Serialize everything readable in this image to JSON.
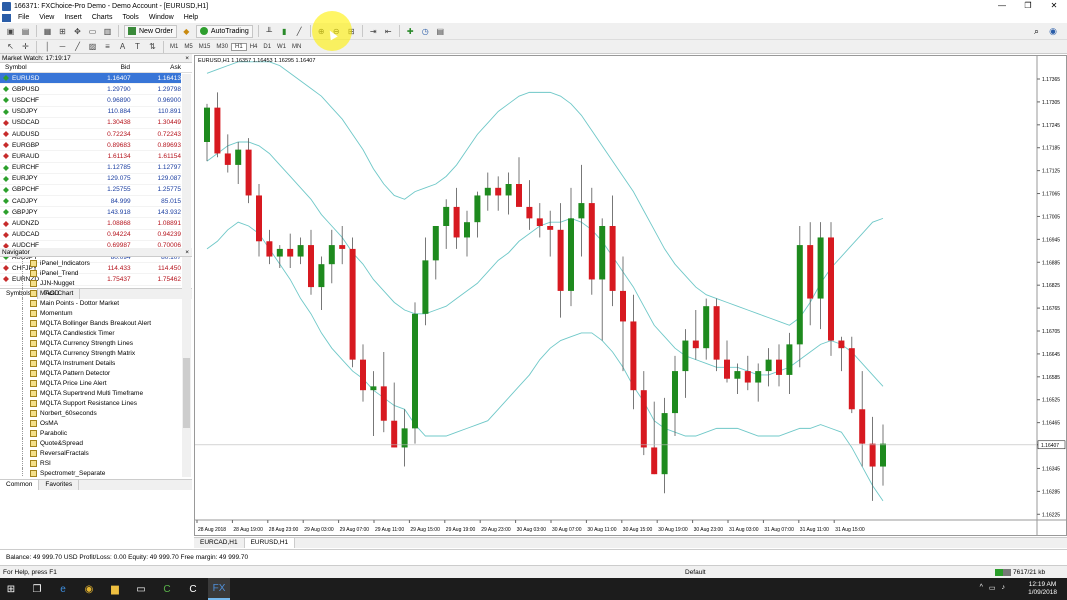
{
  "window": {
    "title": "166371: FXChoice-Pro Demo - Demo Account - [EURUSD,H1]",
    "controls": [
      "—",
      "❐",
      "✕"
    ]
  },
  "menu": [
    "File",
    "View",
    "Insert",
    "Charts",
    "Tools",
    "Window",
    "Help"
  ],
  "toolbar": {
    "new_order": "New Order",
    "autotrading": "AutoTrading"
  },
  "timeframes": [
    "M1",
    "M5",
    "M15",
    "M30",
    "H1",
    "H4",
    "D1",
    "W1",
    "MN"
  ],
  "market_watch": {
    "header": "Market Watch: 17:19:17",
    "columns": [
      "Symbol",
      "Bid",
      "Ask"
    ],
    "rows": [
      {
        "symbol": "EURUSD",
        "bid": "1.16407",
        "ask": "1.16413",
        "dir": "up",
        "selected": true
      },
      {
        "symbol": "GBPUSD",
        "bid": "1.29790",
        "ask": "1.29798",
        "dir": "up"
      },
      {
        "symbol": "USDCHF",
        "bid": "0.96890",
        "ask": "0.96900",
        "dir": "up"
      },
      {
        "symbol": "USDJPY",
        "bid": "110.884",
        "ask": "110.891",
        "dir": "up"
      },
      {
        "symbol": "USDCAD",
        "bid": "1.30438",
        "ask": "1.30449",
        "dir": "down"
      },
      {
        "symbol": "AUDUSD",
        "bid": "0.72234",
        "ask": "0.72243",
        "dir": "down"
      },
      {
        "symbol": "EURGBP",
        "bid": "0.89683",
        "ask": "0.89693",
        "dir": "down"
      },
      {
        "symbol": "EURAUD",
        "bid": "1.61134",
        "ask": "1.61154",
        "dir": "down"
      },
      {
        "symbol": "EURCHF",
        "bid": "1.12785",
        "ask": "1.12797",
        "dir": "up"
      },
      {
        "symbol": "EURJPY",
        "bid": "129.075",
        "ask": "129.087",
        "dir": "up"
      },
      {
        "symbol": "GBPCHF",
        "bid": "1.25755",
        "ask": "1.25775",
        "dir": "up"
      },
      {
        "symbol": "CADJPY",
        "bid": "84.999",
        "ask": "85.015",
        "dir": "up"
      },
      {
        "symbol": "GBPJPY",
        "bid": "143.918",
        "ask": "143.932",
        "dir": "up"
      },
      {
        "symbol": "AUDNZD",
        "bid": "1.08868",
        "ask": "1.08891",
        "dir": "down"
      },
      {
        "symbol": "AUDCAD",
        "bid": "0.94224",
        "ask": "0.94239",
        "dir": "down"
      },
      {
        "symbol": "AUDCHF",
        "bid": "0.69987",
        "ask": "0.70006",
        "dir": "down"
      },
      {
        "symbol": "AUDJPY",
        "bid": "80.094",
        "ask": "80.107",
        "dir": "up"
      },
      {
        "symbol": "CHFJPY",
        "bid": "114.433",
        "ask": "114.450",
        "dir": "down"
      },
      {
        "symbol": "EURNZD",
        "bid": "1.75437",
        "ask": "1.75462",
        "dir": "down"
      }
    ],
    "tabs": [
      "Symbols",
      "Tick Chart"
    ]
  },
  "navigator": {
    "header": "Navigator",
    "items": [
      "iPanel_Indicators",
      "iPanel_Trend",
      "JJN-Nugget",
      "MACD",
      "Main Points - Dottor Market",
      "Momentum",
      "MQLTA Bollinger Bands Breakout Alert",
      "MQLTA Candlestick Timer",
      "MQLTA Currency Strength Lines",
      "MQLTA Currency Strength Matrix",
      "MQLTA Instrument Details",
      "MQLTA Pattern Detector",
      "MQLTA Price Line Alert",
      "MQLTA Supertrend Multi Timeframe",
      "MQLTA Support Resistance Lines",
      "Norbert_60seconds",
      "OsMA",
      "Parabolic",
      "Quote&Spread",
      "ReversalFractals",
      "RSI",
      "Spectrometr_Separate"
    ],
    "tabs": [
      "Common",
      "Favorites"
    ]
  },
  "chart": {
    "label": "EURUSD,H1  1.16357 1.16453 1.16295 1.16407",
    "current_price": "1.16407",
    "tabs": [
      "EURCAD,H1",
      "EURUSD,H1"
    ]
  },
  "chart_data": {
    "type": "candlestick",
    "symbol": "EURUSD",
    "timeframe": "H1",
    "y_ticks": [
      "1.17365",
      "1.17305",
      "1.17245",
      "1.17185",
      "1.17125",
      "1.17065",
      "1.17005",
      "1.16945",
      "1.16885",
      "1.16825",
      "1.16765",
      "1.16705",
      "1.16645",
      "1.16585",
      "1.16525",
      "1.16465",
      "1.16407",
      "1.16345",
      "1.16285",
      "1.16225"
    ],
    "ylim": [
      1.1621,
      1.1742
    ],
    "x_ticks": [
      "28 Aug 2018",
      "28 Aug 19:00",
      "28 Aug 23:00",
      "29 Aug 03:00",
      "29 Aug 07:00",
      "29 Aug 11:00",
      "29 Aug 15:00",
      "29 Aug 19:00",
      "29 Aug 23:00",
      "30 Aug 03:00",
      "30 Aug 07:00",
      "30 Aug 11:00",
      "30 Aug 15:00",
      "30 Aug 19:00",
      "30 Aug 23:00",
      "31 Aug 03:00",
      "31 Aug 07:00",
      "31 Aug 11:00",
      "31 Aug 15:00"
    ],
    "candles": [
      [
        1.172,
        1.173,
        1.1715,
        1.1729
      ],
      [
        1.1729,
        1.1733,
        1.1716,
        1.1717
      ],
      [
        1.1717,
        1.1722,
        1.1712,
        1.1714
      ],
      [
        1.1714,
        1.172,
        1.1709,
        1.1718
      ],
      [
        1.1718,
        1.1721,
        1.1704,
        1.1706
      ],
      [
        1.1706,
        1.1709,
        1.169,
        1.1694
      ],
      [
        1.1694,
        1.1697,
        1.1688,
        1.169
      ],
      [
        1.169,
        1.1693,
        1.1687,
        1.1692
      ],
      [
        1.1692,
        1.1696,
        1.1687,
        1.169
      ],
      [
        1.169,
        1.1695,
        1.1688,
        1.1693
      ],
      [
        1.1693,
        1.1697,
        1.168,
        1.1682
      ],
      [
        1.1682,
        1.169,
        1.1676,
        1.1688
      ],
      [
        1.1688,
        1.1697,
        1.1683,
        1.1693
      ],
      [
        1.1693,
        1.1698,
        1.1688,
        1.1692
      ],
      [
        1.1692,
        1.1695,
        1.1661,
        1.1663
      ],
      [
        1.1663,
        1.1667,
        1.1652,
        1.1655
      ],
      [
        1.1655,
        1.166,
        1.1643,
        1.1656
      ],
      [
        1.1656,
        1.1665,
        1.1644,
        1.1647
      ],
      [
        1.1647,
        1.1657,
        1.164,
        1.164
      ],
      [
        1.164,
        1.165,
        1.1635,
        1.1645
      ],
      [
        1.1645,
        1.1678,
        1.1641,
        1.1675
      ],
      [
        1.1675,
        1.1695,
        1.1672,
        1.1689
      ],
      [
        1.1689,
        1.1698,
        1.1684,
        1.1698
      ],
      [
        1.1698,
        1.1705,
        1.1692,
        1.1703
      ],
      [
        1.1703,
        1.1708,
        1.1692,
        1.1695
      ],
      [
        1.1695,
        1.1702,
        1.169,
        1.1699
      ],
      [
        1.1699,
        1.1707,
        1.1695,
        1.1706
      ],
      [
        1.1706,
        1.1712,
        1.1702,
        1.1708
      ],
      [
        1.1708,
        1.1711,
        1.1702,
        1.1706
      ],
      [
        1.1706,
        1.1712,
        1.1701,
        1.1709
      ],
      [
        1.1709,
        1.1716,
        1.1704,
        1.1703
      ],
      [
        1.1703,
        1.171,
        1.1697,
        1.17
      ],
      [
        1.17,
        1.1704,
        1.1695,
        1.1698
      ],
      [
        1.1698,
        1.1702,
        1.169,
        1.1697
      ],
      [
        1.1697,
        1.1704,
        1.1674,
        1.1681
      ],
      [
        1.1681,
        1.1708,
        1.1677,
        1.17
      ],
      [
        1.17,
        1.1714,
        1.169,
        1.1704
      ],
      [
        1.1704,
        1.1708,
        1.168,
        1.1684
      ],
      [
        1.1684,
        1.17,
        1.1668,
        1.1698
      ],
      [
        1.1698,
        1.1706,
        1.1677,
        1.1681
      ],
      [
        1.1681,
        1.169,
        1.166,
        1.1673
      ],
      [
        1.1673,
        1.168,
        1.165,
        1.1655
      ],
      [
        1.1655,
        1.166,
        1.1638,
        1.164
      ],
      [
        1.164,
        1.1652,
        1.1633,
        1.1633
      ],
      [
        1.1633,
        1.1653,
        1.1628,
        1.1649
      ],
      [
        1.1649,
        1.1664,
        1.1643,
        1.166
      ],
      [
        1.166,
        1.1671,
        1.1653,
        1.1668
      ],
      [
        1.1668,
        1.1676,
        1.1663,
        1.1666
      ],
      [
        1.1666,
        1.1679,
        1.1663,
        1.1677
      ],
      [
        1.1677,
        1.1679,
        1.166,
        1.1663
      ],
      [
        1.1663,
        1.1668,
        1.1657,
        1.1658
      ],
      [
        1.1658,
        1.1662,
        1.1654,
        1.166
      ],
      [
        1.166,
        1.1664,
        1.1655,
        1.1657
      ],
      [
        1.1657,
        1.1662,
        1.1652,
        1.166
      ],
      [
        1.166,
        1.1666,
        1.1656,
        1.1663
      ],
      [
        1.1663,
        1.1667,
        1.1656,
        1.1659
      ],
      [
        1.1659,
        1.167,
        1.1654,
        1.1667
      ],
      [
        1.1667,
        1.1698,
        1.1661,
        1.1693
      ],
      [
        1.1693,
        1.1699,
        1.1672,
        1.1679
      ],
      [
        1.1679,
        1.1699,
        1.1671,
        1.1695
      ],
      [
        1.1695,
        1.1699,
        1.1664,
        1.1668
      ],
      [
        1.1668,
        1.1669,
        1.166,
        1.1666
      ],
      [
        1.1666,
        1.1669,
        1.1649,
        1.165
      ],
      [
        1.165,
        1.166,
        1.1635,
        1.1641
      ],
      [
        1.1641,
        1.1648,
        1.1626,
        1.1635
      ],
      [
        1.1635,
        1.1646,
        1.163,
        1.1641
      ]
    ],
    "bollinger_bands": {
      "upper": [
        1.1738,
        1.1739,
        1.174,
        1.1741,
        1.1741,
        1.1741,
        1.1741,
        1.174,
        1.1738,
        1.1736,
        1.1734,
        1.1732,
        1.1729,
        1.1726,
        1.1722,
        1.1718,
        1.1713,
        1.1709,
        1.1706,
        1.1705,
        1.1707,
        1.1708,
        1.1709,
        1.1711,
        1.1714,
        1.1718,
        1.1722,
        1.1725,
        1.1728,
        1.173,
        1.1732,
        1.1733,
        1.1733,
        1.1733,
        1.1732,
        1.173,
        1.1727,
        1.1723,
        1.1719,
        1.1715,
        1.1711,
        1.1707,
        1.1702,
        1.1697,
        1.1692,
        1.1688,
        1.1685,
        1.1682,
        1.168,
        1.1679,
        1.1678,
        1.1677,
        1.1676,
        1.1675,
        1.1674,
        1.1673,
        1.1672,
        1.1674,
        1.1678,
        1.1683,
        1.1687,
        1.169,
        1.1693,
        1.1696,
        1.1699,
        1.17
      ],
      "middle": [
        1.1715,
        1.1717,
        1.1719,
        1.172,
        1.172,
        1.1719,
        1.1717,
        1.1714,
        1.1711,
        1.1708,
        1.1705,
        1.1701,
        1.1698,
        1.1695,
        1.1691,
        1.1688,
        1.1684,
        1.1681,
        1.1678,
        1.1676,
        1.1675,
        1.1675,
        1.1676,
        1.1677,
        1.1679,
        1.1681,
        1.1683,
        1.1686,
        1.1689,
        1.1691,
        1.1694,
        1.1696,
        1.1698,
        1.1699,
        1.1699,
        1.17,
        1.1699,
        1.1697,
        1.1694,
        1.169,
        1.1686,
        1.1682,
        1.1677,
        1.1672,
        1.1669,
        1.1666,
        1.1664,
        1.1663,
        1.1662,
        1.1661,
        1.1661,
        1.1661,
        1.166,
        1.1659,
        1.1659,
        1.166,
        1.1661,
        1.1663,
        1.1665,
        1.1667,
        1.1668,
        1.1667,
        1.1665,
        1.1662,
        1.1659,
        1.1656
      ],
      "lower": [
        1.1692,
        1.1694,
        1.1697,
        1.1699,
        1.1698,
        1.1696,
        1.1692,
        1.1688,
        1.1684,
        1.1679,
        1.1675,
        1.167,
        1.1666,
        1.1663,
        1.166,
        1.1658,
        1.1655,
        1.1653,
        1.1651,
        1.165,
        1.1646,
        1.1643,
        1.1643,
        1.1643,
        1.1644,
        1.1645,
        1.1646,
        1.1647,
        1.165,
        1.1653,
        1.1656,
        1.1659,
        1.1663,
        1.1666,
        1.1668,
        1.1669,
        1.167,
        1.167,
        1.1668,
        1.1665,
        1.1661,
        1.1656,
        1.1652,
        1.1647,
        1.1645,
        1.1644,
        1.1643,
        1.1643,
        1.1644,
        1.1645,
        1.1645,
        1.1645,
        1.1644,
        1.1643,
        1.1643,
        1.1643,
        1.1644,
        1.1645,
        1.1645,
        1.1646,
        1.1645,
        1.1644,
        1.164,
        1.1635,
        1.163,
        1.1626
      ]
    },
    "colors": {
      "bull": "#1e8a1e",
      "bear": "#d71920",
      "bands": "#6fc8c8",
      "wick": "#555555"
    }
  },
  "terminal": {
    "text": "Balance: 49 999.70 USD  Profit/Loss: 0.00  Equity: 49 999.70  Free margin: 49 999.70"
  },
  "status": {
    "help": "For Help, press F1",
    "profile": "Default",
    "connection": "7617/21 kb"
  },
  "taskbar": {
    "time": "12:19 AM",
    "date": "1/09/2018"
  }
}
